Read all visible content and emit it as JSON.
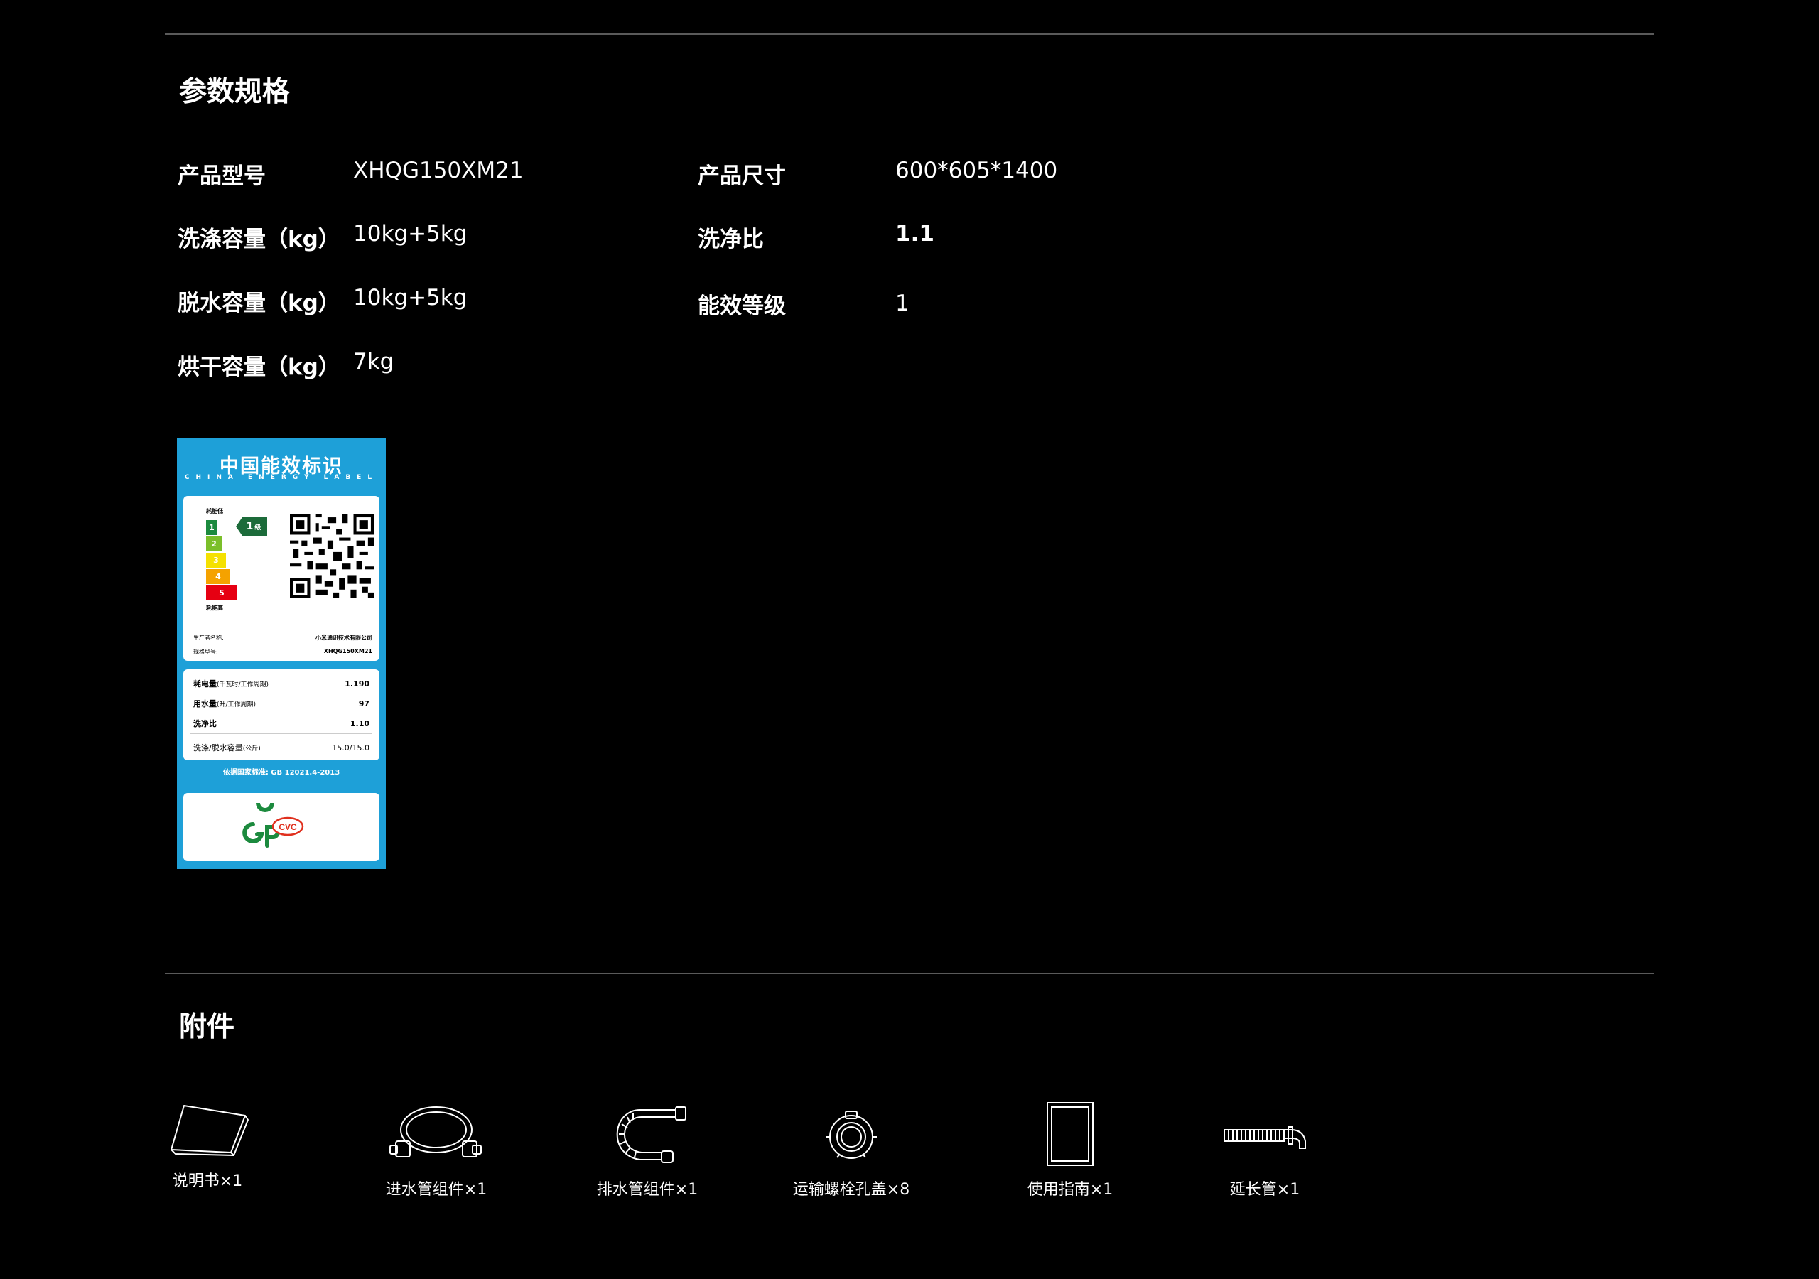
{
  "specs": {
    "title": "参数规格",
    "left": [
      {
        "label": "产品型号",
        "value": "XHQG150XM21"
      },
      {
        "label": "洗涤容量（kg）",
        "value": "10kg+5kg"
      },
      {
        "label": "脱水容量（kg）",
        "value": "10kg+5kg"
      },
      {
        "label": "烘干容量（kg）",
        "value": "7kg"
      }
    ],
    "right": [
      {
        "label": "产品尺寸",
        "value": "600*605*1400"
      },
      {
        "label": "洗净比",
        "value": "1.1"
      },
      {
        "label": "能效等级",
        "value": "1"
      }
    ]
  },
  "energy_label": {
    "title": "中国能效标识",
    "subtitle": "CHINA ENERGY LABEL",
    "low_consumption": "耗能低",
    "high_consumption": "耗能高",
    "grades": [
      "1",
      "2",
      "3",
      "4",
      "5"
    ],
    "grade_colors": [
      "#1c8a3e",
      "#7bbf2a",
      "#f5e100",
      "#f5a200",
      "#e60012"
    ],
    "current_grade": "1",
    "grade_unit": "级",
    "manufacturer_label": "生产者名称:",
    "manufacturer": "小米通讯技术有限公司",
    "model_label": "规格型号:",
    "model": "XHQG150XM21",
    "rows": [
      {
        "label": "耗电量",
        "unit": "(千瓦时/工作周期)",
        "value": "1.190"
      },
      {
        "label": "用水量",
        "unit": "(升/工作周期)",
        "value": "97"
      },
      {
        "label": "洗净比",
        "unit": "",
        "value": "1.10"
      },
      {
        "label": "洗涤/脱水容量",
        "unit": "(公斤)",
        "value": "15.0/15.0"
      }
    ],
    "standard": "依据国家标准: GB 12021.4-2013",
    "cvc_mark": "CVC"
  },
  "accessories": {
    "title": "附件",
    "items": [
      {
        "label": "说明书×1",
        "icon": "manual-icon"
      },
      {
        "label": "进水管组件×1",
        "icon": "inlet-hose-icon"
      },
      {
        "label": "排水管组件×1",
        "icon": "drain-hose-icon"
      },
      {
        "label": "运输螺栓孔盖×8",
        "icon": "bolt-cover-icon"
      },
      {
        "label": "使用指南×1",
        "icon": "guide-icon"
      },
      {
        "label": "延长管×1",
        "icon": "extension-pipe-icon"
      }
    ]
  }
}
